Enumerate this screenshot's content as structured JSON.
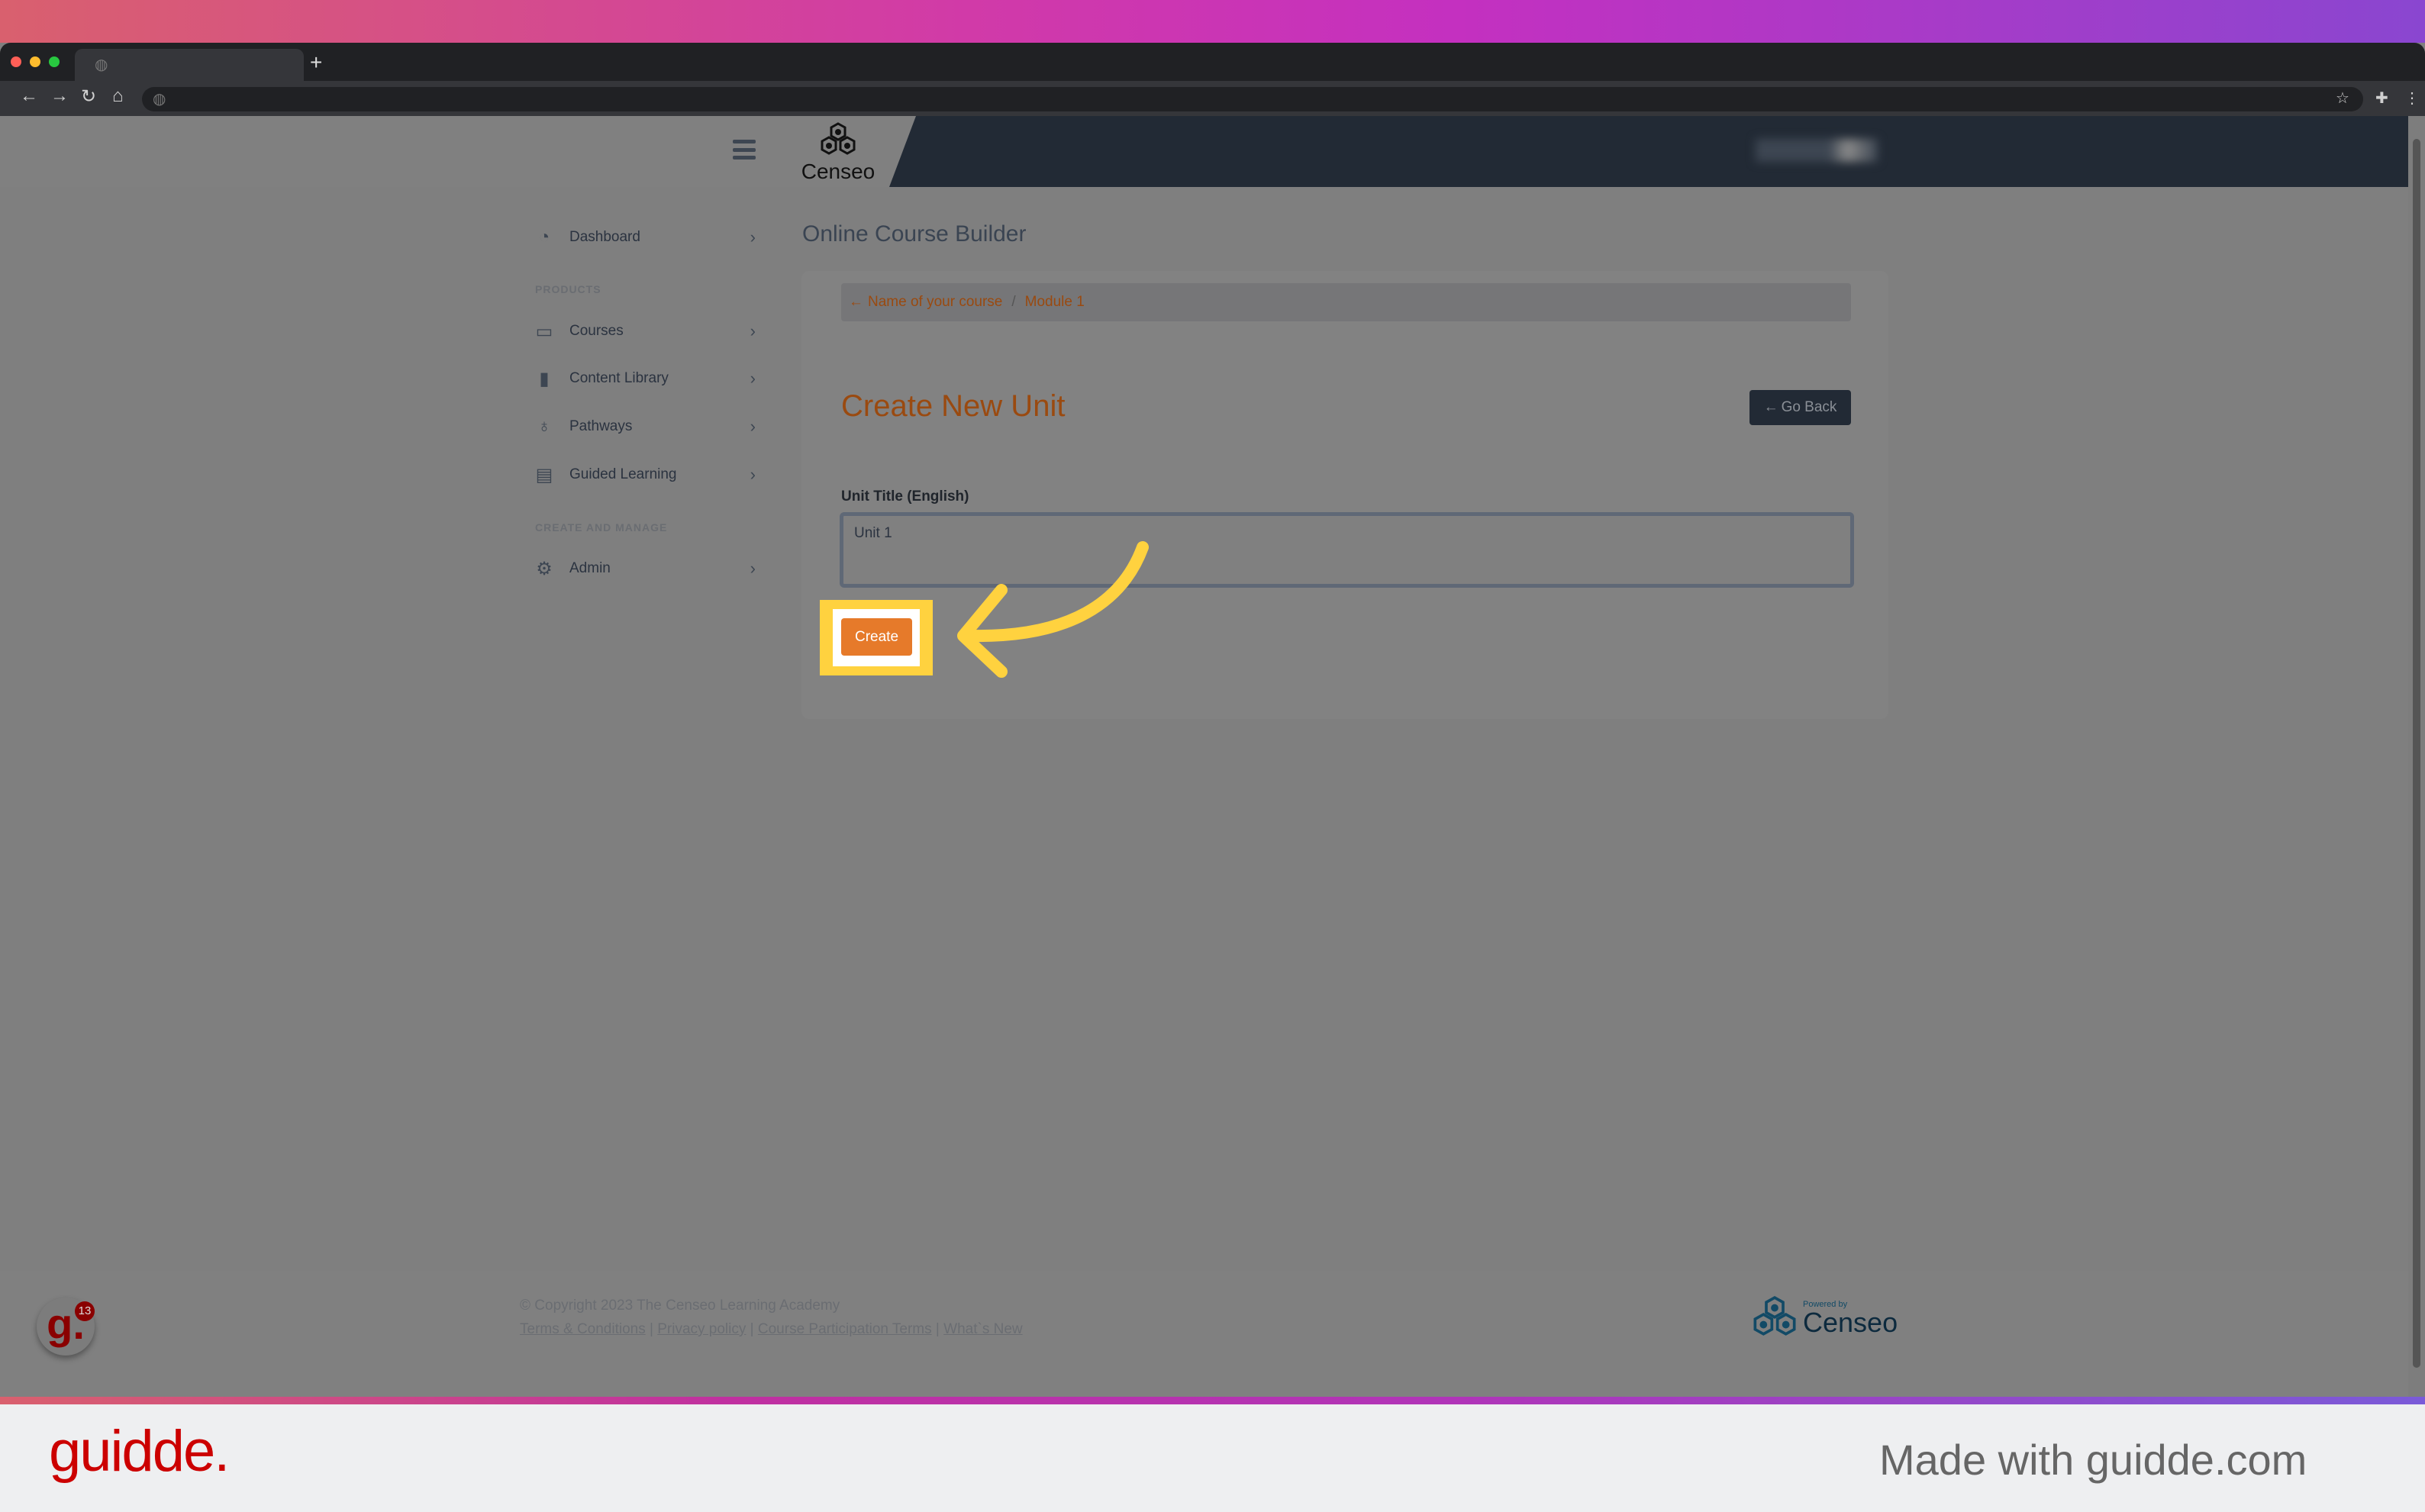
{
  "browser": {
    "new_tab": "+",
    "icons": [
      "back-icon",
      "forward-icon",
      "reload-icon",
      "home-icon",
      "star-icon",
      "extensions-icon",
      "menu-icon"
    ]
  },
  "header": {
    "logo_text": "Censeo"
  },
  "sidebar": {
    "dashboard": "Dashboard",
    "section_products": "PRODUCTS",
    "items": [
      {
        "label": "Courses",
        "icon": "courses-icon"
      },
      {
        "label": "Content Library",
        "icon": "book-icon"
      },
      {
        "label": "Pathways",
        "icon": "award-icon"
      },
      {
        "label": "Guided Learning",
        "icon": "clipboard-icon"
      }
    ],
    "section_manage": "CREATE AND MANAGE",
    "admin": "Admin"
  },
  "main": {
    "page_title": "Online Course Builder",
    "breadcrumb": [
      "Name of your course",
      "Module 1"
    ],
    "breadcrumb_sep": "/",
    "heading": "Create New Unit",
    "go_back": "Go Back",
    "field_label": "Unit Title (English)",
    "field_value": "Unit 1",
    "create": "Create"
  },
  "footer": {
    "copyright": "© Copyright 2023 The Censeo Learning Academy",
    "links": [
      "Terms & Conditions",
      "Privacy policy",
      "Course Participation Terms",
      "What`s New"
    ],
    "powered_by": "Powered by",
    "powered_brand": "Censeo",
    "badge_count": "13"
  },
  "guidde": {
    "logo": "guidde.",
    "made_with": "Made with guidde.com"
  },
  "colors": {
    "accent": "#e67a2a",
    "highlight": "#ffd23f",
    "header_dark": "#222a35"
  }
}
